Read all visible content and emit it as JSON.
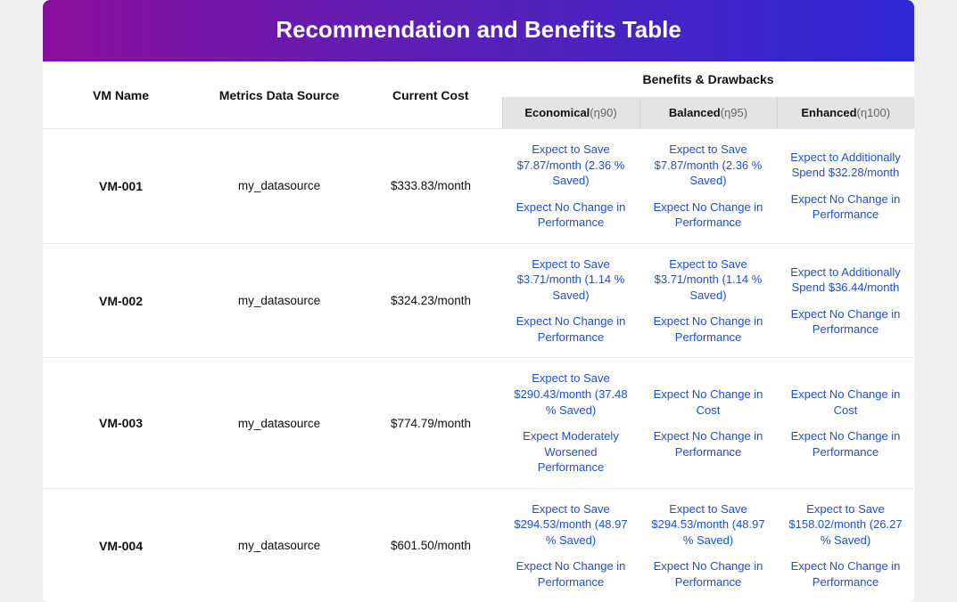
{
  "title": "Recommendation and Benefits Table",
  "headers": {
    "vm": "VM Name",
    "source": "Metrics Data Source",
    "cost": "Current Cost",
    "bd_group": "Benefits & Drawbacks",
    "econ_strong": "Economical",
    "econ_dim": "(η90)",
    "bal_strong": "Balanced",
    "bal_dim": "(η95)",
    "enh_strong": "Enhanced",
    "enh_dim": "(η100)"
  },
  "rows": [
    {
      "vm": "VM-001",
      "source": "my_datasource",
      "cost": "$333.83/month",
      "econ": {
        "l1": "Expect to Save $7.87/month (2.36 % Saved)",
        "l2": "Expect No Change in Performance"
      },
      "bal": {
        "l1": "Expect to Save $7.87/month (2.36 % Saved)",
        "l2": "Expect No Change in Performance"
      },
      "enh": {
        "l1": "Expect to Additionally Spend $32.28/month",
        "l2": "Expect No Change in Performance"
      }
    },
    {
      "vm": "VM-002",
      "source": "my_datasource",
      "cost": "$324.23/month",
      "econ": {
        "l1": "Expect to Save $3.71/month (1.14 % Saved)",
        "l2": "Expect No Change in Performance"
      },
      "bal": {
        "l1": "Expect to Save $3.71/month (1.14 % Saved)",
        "l2": "Expect No Change in Performance"
      },
      "enh": {
        "l1": "Expect to Additionally Spend $36.44/month",
        "l2": "Expect No Change in Performance"
      }
    },
    {
      "vm": "VM-003",
      "source": "my_datasource",
      "cost": "$774.79/month",
      "econ": {
        "l1": "Expect to Save $290.43/month (37.48 % Saved)",
        "l2": "Expect Moderately Worsened Performance"
      },
      "bal": {
        "l1": "Expect No Change in Cost",
        "l2": "Expect No Change in Performance"
      },
      "enh": {
        "l1": "Expect No Change in Cost",
        "l2": "Expect No Change in Performance"
      }
    },
    {
      "vm": "VM-004",
      "source": "my_datasource",
      "cost": "$601.50/month",
      "econ": {
        "l1": "Expect to Save $294.53/month (48.97 % Saved)",
        "l2": "Expect No Change in Performance"
      },
      "bal": {
        "l1": "Expect to Save $294.53/month (48.97 % Saved)",
        "l2": "Expect No Change in Performance"
      },
      "enh": {
        "l1": "Expect to Save $158.02/month (26.27 % Saved)",
        "l2": "Expect No Change in Performance"
      }
    }
  ]
}
